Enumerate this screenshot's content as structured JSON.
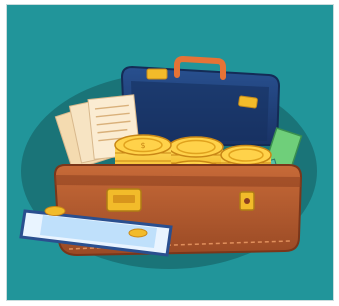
{
  "image": {
    "subject": "briefcase-of-money-illustration",
    "colors": {
      "background": "#21959a",
      "backdrop_blob": "#1a7478",
      "case_leather": "#b55a2f",
      "case_shadow": "#8d3f1f",
      "case_lid": "#1f3c7a",
      "handle": "#e57336",
      "gold": "#f2bb2a",
      "gold_dark": "#d28f16",
      "paper": "#f7e4c3",
      "banknote_green": "#4fb07d",
      "card_blue": "#cfe6fb"
    },
    "icons": [
      "briefcase-icon",
      "coin-stack-icon",
      "banknote-icon",
      "paper-stack-icon",
      "check-card-icon",
      "case-lock-icon"
    ]
  }
}
